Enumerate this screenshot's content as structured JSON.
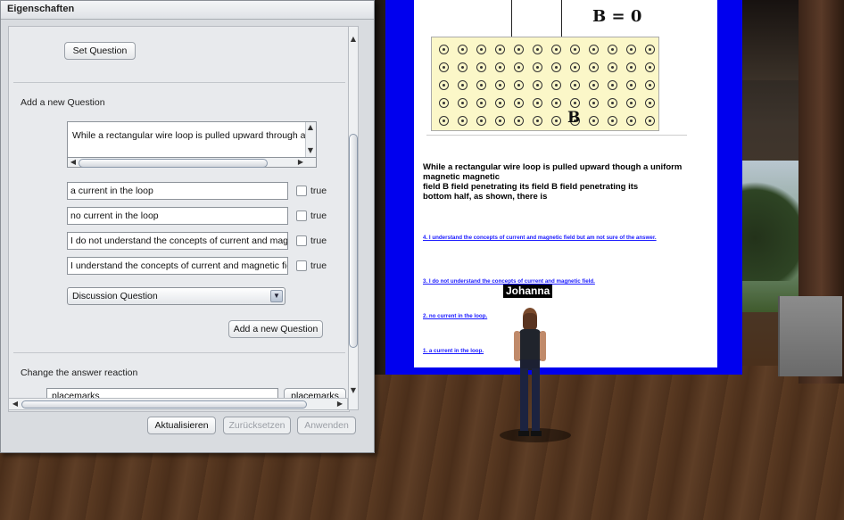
{
  "dialog": {
    "title": "Eigenschaften",
    "set_question_label": "Set Question",
    "add_section_title": "Add a new Question",
    "question_text": "While a rectangular wire loop is pulled upward through a uni",
    "answers": [
      {
        "text": "a current in the loop",
        "true_label": "true",
        "checked": false
      },
      {
        "text": "no current in the loop",
        "true_label": "true",
        "checked": false
      },
      {
        "text": "I do not understand the concepts of current and magn",
        "true_label": "true",
        "checked": false
      },
      {
        "text": "I understand the concepts of current and magnetic fiel",
        "true_label": "true",
        "checked": false
      }
    ],
    "question_type": "Discussion Question",
    "add_question_label": "Add a new Question",
    "answer_reaction_title": "Change the answer reaction",
    "placemarks_value": "placemarks",
    "placemarks_button": "placemarks",
    "footer": {
      "update_label": "Aktualisieren",
      "reset_label": "Zurücksetzen",
      "apply_label": "Anwenden"
    }
  },
  "scene": {
    "equation": "B = 0",
    "field_label": "B",
    "question": "While a rectangular wire loop is pulled upward though a uniform\nmagnetic magnetic\nfield B field penetrating its field B field penetrating its\nbottom half, as shown, there is",
    "answer_links": [
      "4. I understand the concepts of current and magnetic field but am not sure of the answer.",
      "3. I do not understand the concepts of current and magnetic field.",
      "2. no current in the loop.",
      "1. a current in the loop."
    ],
    "avatar_name": "Johanna"
  },
  "colors": {
    "screen_border": "#0000ee",
    "link": "#1a1aff",
    "dialog_bg": "#d9dce0"
  }
}
